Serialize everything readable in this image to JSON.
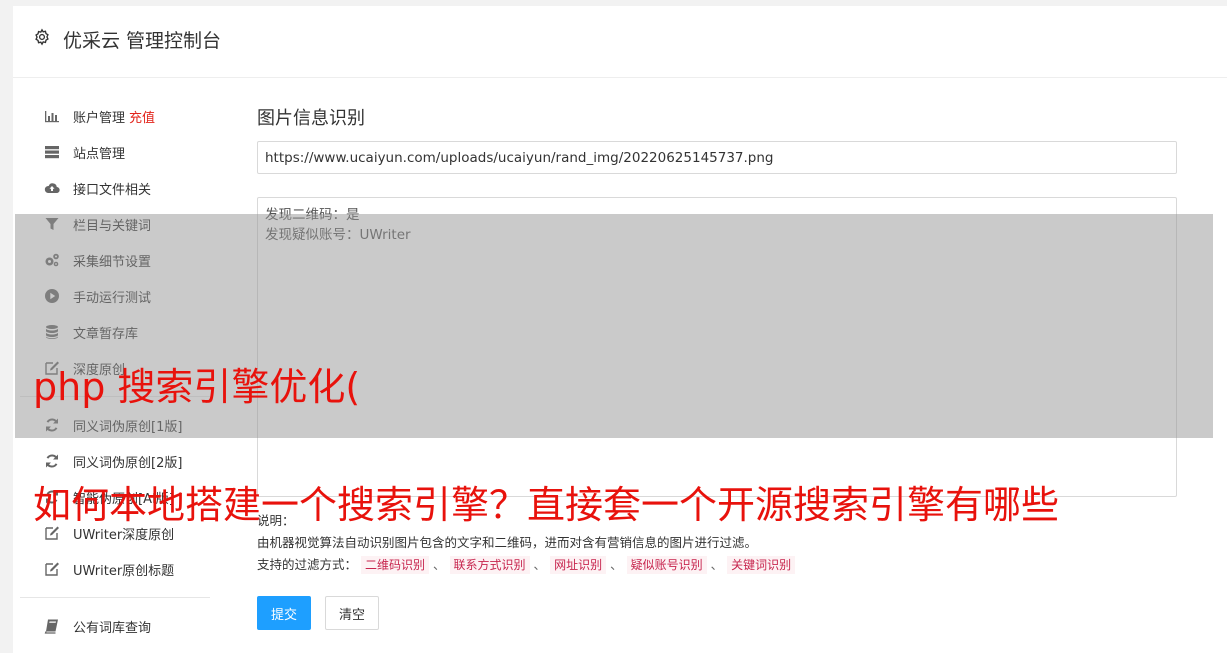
{
  "header": {
    "title": "优采云 管理控制台",
    "icon": "gear-icon"
  },
  "sidebar": {
    "items": [
      {
        "label": "账户管理",
        "icon": "bar-chart-icon",
        "extra": "充值"
      },
      {
        "label": "站点管理",
        "icon": "server-icon"
      },
      {
        "label": "接口文件相关",
        "icon": "cloud-upload-icon"
      },
      {
        "label": "栏目与关键词",
        "icon": "filter-icon"
      },
      {
        "label": "采集细节设置",
        "icon": "gears-icon"
      },
      {
        "label": "手动运行测试",
        "icon": "play-circle-icon"
      },
      {
        "label": "文章暂存库",
        "icon": "database-icon"
      },
      {
        "label": "深度原创",
        "icon": "edit-icon"
      },
      {
        "label": "同义词伪原创[1版]",
        "icon": "refresh-icon"
      },
      {
        "label": "同义词伪原创[2版]",
        "icon": "refresh-icon"
      },
      {
        "label": "智能伪原创[AI版]",
        "icon": "refresh-icon"
      },
      {
        "label": "UWriter深度原创",
        "icon": "edit-icon"
      },
      {
        "label": "UWriter原创标题",
        "icon": "edit-icon"
      },
      {
        "label": "公有词库查询",
        "icon": "book-icon"
      }
    ]
  },
  "main": {
    "title": "图片信息识别",
    "url_value": "https://www.ucaiyun.com/uploads/ucaiyun/rand_img/20220625145737.png",
    "result_lines": [
      "发现二维码：是",
      "发现疑似账号：UWriter"
    ],
    "desc_label": "说明：",
    "desc_text": "由机器视觉算法自动识别图片包含的文字和二维码，进而对含有营销信息的图片进行过滤。",
    "filter_label": "支持的过滤方式：",
    "filters": [
      "二维码识别",
      "联系方式识别",
      "网址识别",
      "疑似账号识别",
      "关键词识别"
    ],
    "filter_sep": "、",
    "submit_label": "提交",
    "clear_label": "清空"
  },
  "overlay": {
    "line1": "php 搜索引擎优化(",
    "line2": "如何本地搭建一个搜索引擎？直接套一个开源搜索引擎有哪些"
  },
  "colors": {
    "accent": "#1e9fff",
    "recharge": "#e2231a",
    "overlay_text": "#e8120c"
  }
}
